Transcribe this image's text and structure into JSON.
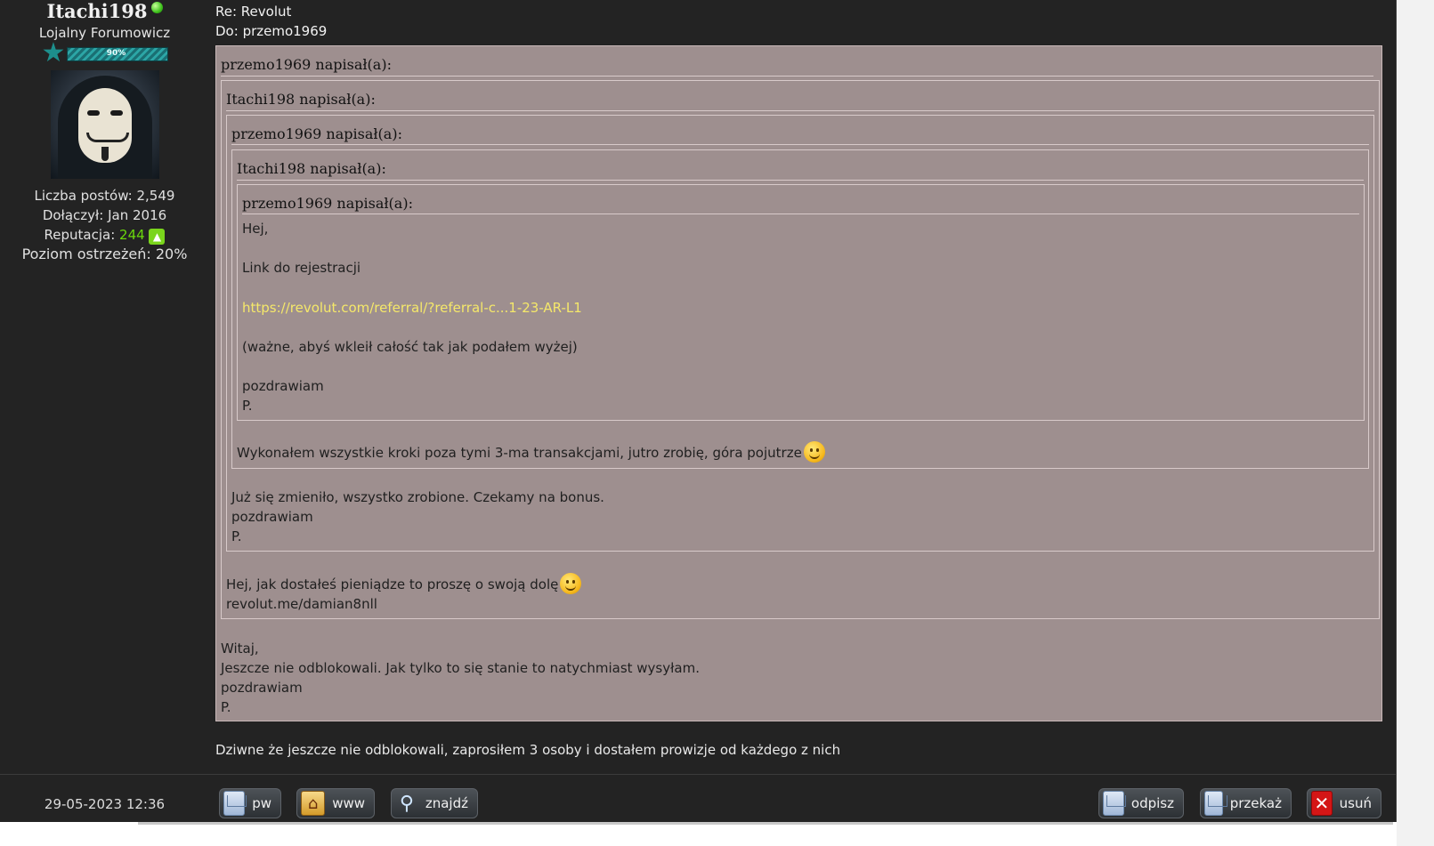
{
  "profile": {
    "username": "Itachi198",
    "rank": "Lojalny Forumowicz",
    "rank_progress_label": "90%",
    "rank_progress": 0.9,
    "posts": "Liczba postów: 2,549",
    "joined": "Dołączył: Jan 2016",
    "reputation_label": "Reputacja:",
    "reputation_value": "244",
    "warning": "Poziom ostrzeżeń: 20%",
    "online_color": "#3fc21c"
  },
  "message": {
    "subject": "Re: Revolut",
    "to_label": "Do: ",
    "to_value": "przemo1969"
  },
  "quotes": {
    "q1_head": "przemo1969 napisał(a):",
    "q2_head": "Itachi198 napisał(a):",
    "q3_head": "przemo1969 napisał(a):",
    "q4_head": "Itachi198 napisał(a):",
    "q5_head": "przemo1969 napisał(a):",
    "q5_lines": {
      "l1": "Hej,",
      "l2": "Link do rejestracji",
      "link": "https://revolut.com/referral/?referral-c...1-23-AR-L1",
      "l3": "(ważne, abyś wkleił całość tak jak podałem wyżej)",
      "l4": "pozdrawiam",
      "l5": "P."
    },
    "q4_body": "Wykonałem wszystkie kroki poza tymi 3-ma transakcjami, jutro zrobię, góra pojutrze",
    "q3_body": {
      "l1": "Już się zmieniło, wszystko zrobione. Czekamy na bonus.",
      "l2": "pozdrawiam",
      "l3": "P."
    },
    "q2_body": {
      "l1": "Hej, jak dostałeś pieniądze to proszę o swoją dolę",
      "l2": "revolut.me/damian8nll"
    },
    "q1_body": {
      "l1": "Witaj,",
      "l2": "Jeszcze nie odblokowali. Jak tylko to się stanie to natychmiast wysyłam.",
      "l3": "pozdrawiam",
      "l4": "P."
    }
  },
  "reply": "Dziwne że jeszcze nie odblokowali, zaprosiłem 3 osoby i dostałem prowizje od każdego z nich",
  "footer": {
    "timestamp": "29-05-2023 12:36",
    "buttons": {
      "pw": "pw",
      "www": "www",
      "find": "znajdź",
      "reply": "odpisz",
      "forward": "przekaż",
      "delete": "usuń"
    }
  },
  "colors": {
    "quote_bg": "#9e8f8f",
    "link": "#f5e86a",
    "reputation": "#6bd80c",
    "background": "#232323"
  }
}
